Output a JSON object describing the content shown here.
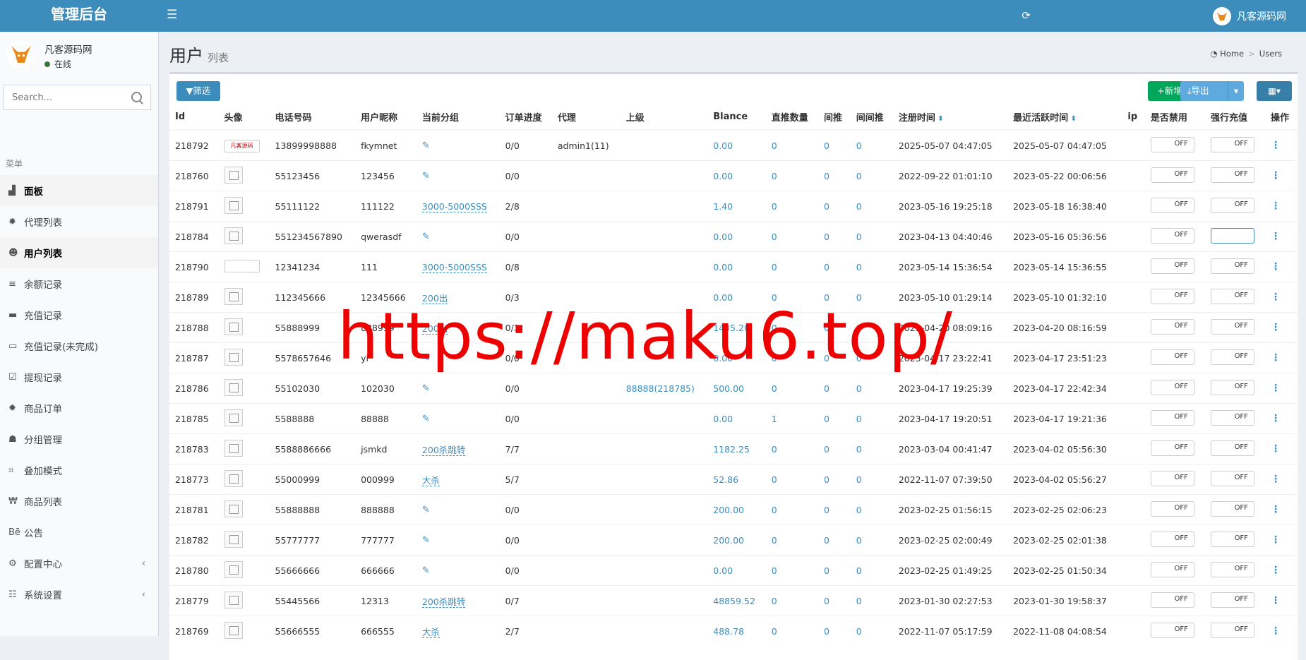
{
  "header": {
    "logo": "管理后台",
    "menu_icon": "hamburger-icon",
    "refresh_icon": "refresh-icon",
    "user_name": "凡客源码网"
  },
  "sidebar": {
    "user_name": "凡客源码网",
    "status": "在线",
    "search_placeholder": "Search...",
    "menu_header": "菜单",
    "items": [
      {
        "label": "面板",
        "icon": "dashboard-icon"
      },
      {
        "label": "代理列表",
        "icon": "gear-icon"
      },
      {
        "label": "用户列表",
        "icon": "user-icon"
      },
      {
        "label": "余额记录",
        "icon": "list-icon"
      },
      {
        "label": "充值记录",
        "icon": "card-icon"
      },
      {
        "label": "充值记录(未完成)",
        "icon": "card-outline-icon"
      },
      {
        "label": "提现记录",
        "icon": "check-square-icon"
      },
      {
        "label": "商品订单",
        "icon": "gear-icon"
      },
      {
        "label": "分组管理",
        "icon": "users-icon"
      },
      {
        "label": "叠加模式",
        "icon": "sitemap-icon"
      },
      {
        "label": "商品列表",
        "icon": "product-icon"
      },
      {
        "label": "公告",
        "icon": "behance-icon"
      },
      {
        "label": "配置中心",
        "icon": "cog-icon"
      },
      {
        "label": "系统设置",
        "icon": "settings-list-icon"
      }
    ]
  },
  "page": {
    "title": "用户",
    "subtitle": "列表",
    "breadcrumb": [
      "Home",
      "Users"
    ]
  },
  "toolbar": {
    "filter": "筛选",
    "new": "新增",
    "export": "导出"
  },
  "table": {
    "columns": [
      "Id",
      "头像",
      "电话号码",
      "用户昵称",
      "当前分组",
      "订单进度",
      "代理",
      "上级",
      "Blance",
      "直推数量",
      "间推",
      "间间推",
      "注册时间",
      "最近活跃时间",
      "ip",
      "是否禁用",
      "强行充值",
      "操作"
    ],
    "rows": [
      {
        "id": "218792",
        "avatar": "wide",
        "avatar_text": "凡客源码",
        "phone": "13899998888",
        "nick": "fkymnet",
        "group": "",
        "progress": "0/0",
        "agent": "admin1(11)",
        "parent": "",
        "balance": "0.00",
        "direct": "0",
        "indirect": "0",
        "indirect2": "0",
        "reg": "2025-05-07 04:47:05",
        "active": "2025-05-07 04:47:05",
        "ip": "",
        "disabled": "OFF",
        "force": "OFF"
      },
      {
        "id": "218760",
        "avatar": "img",
        "phone": "55123456",
        "nick": "123456",
        "group": "",
        "progress": "0/0",
        "agent": "",
        "parent": "",
        "balance": "0.00",
        "direct": "0",
        "indirect": "0",
        "indirect2": "0",
        "reg": "2022-09-22 01:01:10",
        "active": "2023-05-22 00:06:56",
        "ip": "",
        "disabled": "OFF",
        "force": "OFF"
      },
      {
        "id": "218791",
        "avatar": "img",
        "phone": "55111122",
        "nick": "111122",
        "group": "3000-5000SSS",
        "progress": "2/8",
        "agent": "",
        "parent": "",
        "balance": "1.40",
        "direct": "0",
        "indirect": "0",
        "indirect2": "0",
        "reg": "2023-05-16 19:25:18",
        "active": "2023-05-18 16:38:40",
        "ip": "",
        "disabled": "OFF",
        "force": "OFF"
      },
      {
        "id": "218784",
        "avatar": "img",
        "phone": "551234567890",
        "nick": "qwerasdf",
        "group": "",
        "progress": "0/0",
        "agent": "",
        "parent": "",
        "balance": "0.00",
        "direct": "0",
        "indirect": "0",
        "indirect2": "0",
        "reg": "2023-04-13 04:40:46",
        "active": "2023-05-16 05:36:56",
        "ip": "",
        "disabled": "OFF",
        "force": "ON"
      },
      {
        "id": "218790",
        "avatar": "wide",
        "avatar_text": "",
        "phone": "12341234",
        "nick": "111",
        "group": "3000-5000SSS",
        "progress": "0/8",
        "agent": "",
        "parent": "",
        "balance": "0.00",
        "direct": "0",
        "indirect": "0",
        "indirect2": "0",
        "reg": "2023-05-14 15:36:54",
        "active": "2023-05-14 15:36:55",
        "ip": "",
        "disabled": "OFF",
        "force": "OFF"
      },
      {
        "id": "218789",
        "avatar": "img",
        "phone": "112345666",
        "nick": "12345666",
        "group": "200出",
        "progress": "0/3",
        "agent": "",
        "parent": "",
        "balance": "0.00",
        "direct": "0",
        "indirect": "0",
        "indirect2": "0",
        "reg": "2023-05-10 01:29:14",
        "active": "2023-05-10 01:32:10",
        "ip": "",
        "disabled": "OFF",
        "force": "OFF"
      },
      {
        "id": "218788",
        "avatar": "img",
        "phone": "55888999",
        "nick": "888999",
        "group": "200出",
        "progress": "0/3",
        "agent": "",
        "parent": "",
        "balance": "1435.20",
        "direct": "0",
        "indirect": "0",
        "indirect2": "0",
        "reg": "2023-04-20 08:09:16",
        "active": "2023-04-20 08:16:59",
        "ip": "",
        "disabled": "OFF",
        "force": "OFF"
      },
      {
        "id": "218787",
        "avatar": "img",
        "phone": "5578657646",
        "nick": "yi",
        "group": "",
        "progress": "0/0",
        "agent": "",
        "parent": "",
        "balance": "0.00",
        "direct": "0",
        "indirect": "0",
        "indirect2": "0",
        "reg": "2023-04-17 23:22:41",
        "active": "2023-04-17 23:51:23",
        "ip": "",
        "disabled": "OFF",
        "force": "OFF"
      },
      {
        "id": "218786",
        "avatar": "img",
        "phone": "55102030",
        "nick": "102030",
        "group": "",
        "progress": "0/0",
        "agent": "",
        "parent": "88888(218785)",
        "balance": "500.00",
        "direct": "0",
        "indirect": "0",
        "indirect2": "0",
        "reg": "2023-04-17 19:25:39",
        "active": "2023-04-17 22:42:34",
        "ip": "",
        "disabled": "OFF",
        "force": "OFF"
      },
      {
        "id": "218785",
        "avatar": "img",
        "phone": "5588888",
        "nick": "88888",
        "group": "",
        "progress": "0/0",
        "agent": "",
        "parent": "",
        "balance": "0.00",
        "direct": "1",
        "indirect": "0",
        "indirect2": "0",
        "reg": "2023-04-17 19:20:51",
        "active": "2023-04-17 19:21:36",
        "ip": "",
        "disabled": "OFF",
        "force": "OFF"
      },
      {
        "id": "218783",
        "avatar": "img",
        "phone": "5588886666",
        "nick": "jsmkd",
        "group": "200杀跳转",
        "progress": "7/7",
        "agent": "",
        "parent": "",
        "balance": "1182.25",
        "direct": "0",
        "indirect": "0",
        "indirect2": "0",
        "reg": "2023-03-04 00:41:47",
        "active": "2023-04-02 05:56:30",
        "ip": "",
        "disabled": "OFF",
        "force": "OFF"
      },
      {
        "id": "218773",
        "avatar": "img",
        "phone": "55000999",
        "nick": "000999",
        "group": "大杀",
        "progress": "5/7",
        "agent": "",
        "parent": "",
        "balance": "52.86",
        "direct": "0",
        "indirect": "0",
        "indirect2": "0",
        "reg": "2022-11-07 07:39:50",
        "active": "2023-04-02 05:56:27",
        "ip": "",
        "disabled": "OFF",
        "force": "OFF"
      },
      {
        "id": "218781",
        "avatar": "img",
        "phone": "55888888",
        "nick": "888888",
        "group": "",
        "progress": "0/0",
        "agent": "",
        "parent": "",
        "balance": "200.00",
        "direct": "0",
        "indirect": "0",
        "indirect2": "0",
        "reg": "2023-02-25 01:56:15",
        "active": "2023-02-25 02:06:23",
        "ip": "",
        "disabled": "OFF",
        "force": "OFF"
      },
      {
        "id": "218782",
        "avatar": "img",
        "phone": "55777777",
        "nick": "777777",
        "group": "",
        "progress": "0/0",
        "agent": "",
        "parent": "",
        "balance": "200.00",
        "direct": "0",
        "indirect": "0",
        "indirect2": "0",
        "reg": "2023-02-25 02:00:49",
        "active": "2023-02-25 02:01:38",
        "ip": "",
        "disabled": "OFF",
        "force": "OFF"
      },
      {
        "id": "218780",
        "avatar": "img",
        "phone": "55666666",
        "nick": "666666",
        "group": "",
        "progress": "0/0",
        "agent": "",
        "parent": "",
        "balance": "0.00",
        "direct": "0",
        "indirect": "0",
        "indirect2": "0",
        "reg": "2023-02-25 01:49:25",
        "active": "2023-02-25 01:50:34",
        "ip": "",
        "disabled": "OFF",
        "force": "OFF"
      },
      {
        "id": "218779",
        "avatar": "img",
        "phone": "55445566",
        "nick": "12313",
        "group": "200杀跳转",
        "progress": "0/7",
        "agent": "",
        "parent": "",
        "balance": "48859.52",
        "direct": "0",
        "indirect": "0",
        "indirect2": "0",
        "reg": "2023-01-30 02:27:53",
        "active": "2023-01-30 19:58:37",
        "ip": "",
        "disabled": "OFF",
        "force": "OFF"
      },
      {
        "id": "218769",
        "avatar": "img",
        "phone": "55666555",
        "nick": "666555",
        "group": "大杀",
        "progress": "2/7",
        "agent": "",
        "parent": "",
        "balance": "488.78",
        "direct": "0",
        "indirect": "0",
        "indirect2": "0",
        "reg": "2022-11-07 05:17:59",
        "active": "2022-11-08 04:08:54",
        "ip": "",
        "disabled": "OFF",
        "force": "OFF"
      }
    ]
  },
  "watermark": "https://maku6.top/"
}
